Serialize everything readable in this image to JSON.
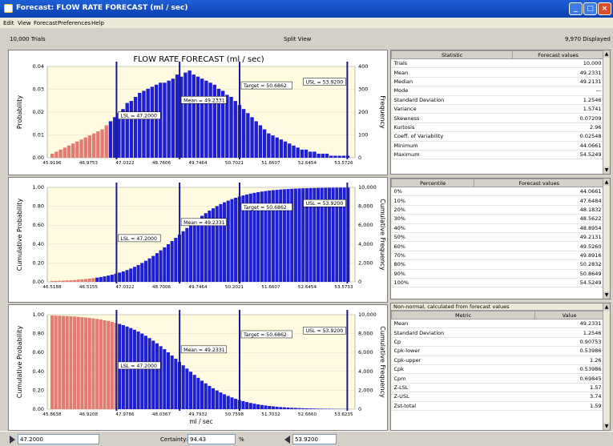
{
  "window": {
    "title": "Forecast: FLOW RATE FORECAST (ml / sec)"
  },
  "menu": [
    "Edit",
    "View",
    "Forecast",
    "Preferences",
    "Help"
  ],
  "info": {
    "trials": "10,000 Trials",
    "view": "Split View",
    "displayed": "9,970 Displayed"
  },
  "colors": {
    "accent": "#1f1fd2",
    "tail": "#e27c72",
    "spec_line": "#1a1a8a"
  },
  "chart_data": [
    {
      "type": "bar",
      "title": "FLOW RATE FORECAST (ml / sec)",
      "ylabel": "Probability",
      "y2label": "Frequency",
      "yticks": [
        "0.04",
        "0.03",
        "0.02",
        "0.01",
        "0.00"
      ],
      "y2ticks": [
        "400",
        "300",
        "200",
        "100",
        "0"
      ],
      "xticks": [
        "45.9196",
        "46.9753",
        "47.0322",
        "48.7606",
        "49.7464",
        "50.7021",
        "51.6607",
        "52.6454",
        "53.5726"
      ],
      "ylim": [
        0,
        0.045
      ],
      "values": [
        0.002,
        0.003,
        0.004,
        0.005,
        0.006,
        0.007,
        0.008,
        0.009,
        0.01,
        0.011,
        0.012,
        0.013,
        0.014,
        0.016,
        0.018,
        0.02,
        0.022,
        0.024,
        0.027,
        0.028,
        0.03,
        0.032,
        0.033,
        0.034,
        0.035,
        0.036,
        0.037,
        0.037,
        0.038,
        0.039,
        0.041,
        0.04,
        0.042,
        0.043,
        0.041,
        0.04,
        0.039,
        0.038,
        0.037,
        0.036,
        0.034,
        0.033,
        0.031,
        0.03,
        0.028,
        0.026,
        0.024,
        0.022,
        0.02,
        0.018,
        0.016,
        0.014,
        0.012,
        0.011,
        0.01,
        0.009,
        0.008,
        0.007,
        0.006,
        0.005,
        0.004,
        0.004,
        0.003,
        0.003,
        0.002,
        0.002,
        0.002,
        0.001,
        0.001,
        0.001,
        0.001,
        0.001
      ],
      "split_bin": 14,
      "markers": [
        {
          "label": "LSL = 47.2000",
          "at": 0.225
        },
        {
          "label": "Mean = 49.2331",
          "at": 0.43
        },
        {
          "label": "Target = 50.6862",
          "at": 0.625
        },
        {
          "label": "USL = 53.9200",
          "at": 0.975
        }
      ]
    },
    {
      "type": "area",
      "ylabel": "Cumulative Probability",
      "y2label": "Cumulative Frequency",
      "yticks": [
        "1.00",
        "0.80",
        "0.60",
        "0.40",
        "0.20",
        "0.00"
      ],
      "y2ticks": [
        "10,000",
        "8,000",
        "6,000",
        "4,000",
        "2,000",
        "0"
      ],
      "xticks": [
        "46.5188",
        "46.5155",
        "47.0322",
        "48.7006",
        "49.7464",
        "50.2021",
        "51.6607",
        "52.6454",
        "53.5733"
      ],
      "ylim": [
        0,
        1
      ],
      "split_x": 0.14,
      "markers": [
        {
          "label": "LSL = 47.2000",
          "at": 0.225
        },
        {
          "label": "Mean = 49.2331",
          "at": 0.43
        },
        {
          "label": "Target = 50.6862",
          "at": 0.625
        },
        {
          "label": "USL = 53.9200",
          "at": 0.975
        }
      ]
    },
    {
      "type": "area",
      "ylabel": "Cumulative Probability",
      "y2label": "Cumulative Frequency",
      "xlabel": "ml / sec",
      "yticks": [
        "1.00",
        "0.80",
        "0.60",
        "0.40",
        "0.20",
        "0.00"
      ],
      "y2ticks": [
        "10,000",
        "8,000",
        "6,000",
        "4,000",
        "2,000",
        "0"
      ],
      "xticks": [
        "45.8638",
        "46.9208",
        "47.9786",
        "48.0367",
        "49.7932",
        "50.7598",
        "51.7032",
        "52.6660",
        "53.6235"
      ],
      "ylim": [
        0,
        1
      ],
      "split_x": 0.225,
      "markers": [
        {
          "label": "LSL = 47.2000",
          "at": 0.225
        },
        {
          "label": "Mean = 49.2331",
          "at": 0.43
        },
        {
          "label": "Target = 50.6862",
          "at": 0.625
        },
        {
          "label": "USL = 53.9200",
          "at": 0.975
        }
      ]
    }
  ],
  "stats": {
    "headers": [
      "Statistic",
      "Forecast values"
    ],
    "rows": [
      [
        "Trials",
        "10,000"
      ],
      [
        "Mean",
        "49.2331"
      ],
      [
        "Median",
        "49.2131"
      ],
      [
        "Mode",
        "---"
      ],
      [
        "Standard Deviation",
        "1.2546"
      ],
      [
        "Variance",
        "1.5741"
      ],
      [
        "Skewness",
        "0.07209"
      ],
      [
        "Kurtosis",
        "2.96"
      ],
      [
        "Coeff. of Variability",
        "0.02548"
      ],
      [
        "Minimum",
        "44.0661"
      ],
      [
        "Maximum",
        "54.5249"
      ]
    ]
  },
  "percentiles": {
    "headers": [
      "Percentile",
      "Forecast values"
    ],
    "rows": [
      [
        "0%",
        "44.0661"
      ],
      [
        "10%",
        "47.6484"
      ],
      [
        "20%",
        "48.1832"
      ],
      [
        "30%",
        "48.5622"
      ],
      [
        "40%",
        "48.8954"
      ],
      [
        "50%",
        "49.2131"
      ],
      [
        "60%",
        "49.5260"
      ],
      [
        "70%",
        "49.8916"
      ],
      [
        "80%",
        "50.2832"
      ],
      [
        "90%",
        "50.8649"
      ],
      [
        "100%",
        "54.5249"
      ]
    ]
  },
  "capability": {
    "caption": "Non-normal, calculated from forecast values",
    "headers": [
      "Metric",
      "Value"
    ],
    "rows": [
      [
        "Mean",
        "49.2331"
      ],
      [
        "Standard Deviation",
        "1.2546"
      ],
      [
        "Cp",
        "0.90753"
      ],
      [
        "Cpk-lower",
        "0.53986"
      ],
      [
        "Cpk-upper",
        "1.26"
      ],
      [
        "Cpk",
        "0.53986"
      ],
      [
        "Cpm",
        "0.69845"
      ],
      [
        "Z-LSL",
        "1.57"
      ],
      [
        "Z-USL",
        "3.74"
      ],
      [
        "Zst-total",
        "1.59"
      ]
    ]
  },
  "bottom": {
    "left_value": "47.2000",
    "certainty_label": "Certainty:",
    "certainty_value": "94.43",
    "percent": "%",
    "right_value": "53.9200"
  }
}
